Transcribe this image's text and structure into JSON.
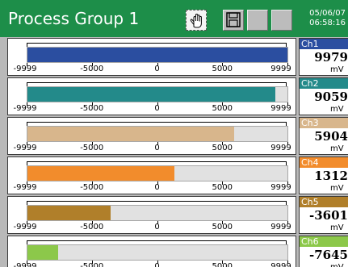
{
  "header": {
    "title": "Process Group 1",
    "date": "05/06/07",
    "time": "06:58:16",
    "buttons": [
      {
        "name": "hand-pointer-button",
        "pressed": true,
        "icon": "hand-pointer-icon"
      },
      {
        "name": "floppy-disk-button",
        "pressed": false,
        "icon": "floppy-disk-icon"
      },
      {
        "name": "blank-button-1",
        "pressed": false,
        "icon": ""
      },
      {
        "name": "blank-button-2",
        "pressed": false,
        "icon": ""
      }
    ],
    "colors": {
      "titlebar": "#1d8e49",
      "title_text": "#ffffff"
    }
  },
  "scale": {
    "min": -9999,
    "max": 9999,
    "tick_labels": [
      "-9999",
      "-5000",
      "0",
      "5000",
      "9999"
    ],
    "tick_values": [
      -9999,
      -5000,
      0,
      5000,
      9999
    ]
  },
  "channels": [
    {
      "label": "Ch1",
      "value": "9979",
      "numeric": 9979,
      "unit": "mV",
      "color": "#2b4ea0"
    },
    {
      "label": "Ch2",
      "value": "9059",
      "numeric": 9059,
      "unit": "mV",
      "color": "#238a8a"
    },
    {
      "label": "Ch3",
      "value": "5904",
      "numeric": 5904,
      "unit": "mV",
      "color": "#d8b68c"
    },
    {
      "label": "Ch4",
      "value": "1312",
      "numeric": 1312,
      "unit": "mV",
      "color": "#f28c2c"
    },
    {
      "label": "Ch5",
      "value": "-3601",
      "numeric": -3601,
      "unit": "mV",
      "color": "#b07f2a"
    },
    {
      "label": "Ch6",
      "value": "-7645",
      "numeric": -7645,
      "unit": "mV",
      "color": "#8cc84a"
    }
  ]
}
